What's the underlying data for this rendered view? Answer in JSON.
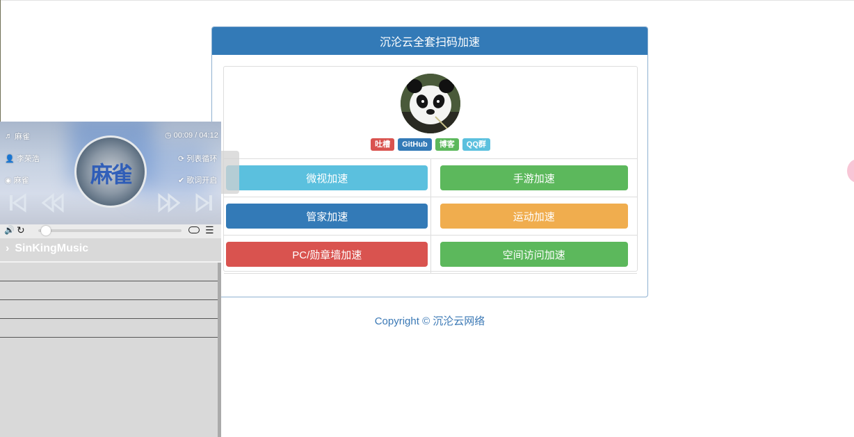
{
  "panel": {
    "title": "沉沦云全套扫码加速"
  },
  "tags": [
    {
      "label": "吐槽",
      "color": "#d9534f"
    },
    {
      "label": "GitHub",
      "color": "#337ab7"
    },
    {
      "label": "博客",
      "color": "#5cb85c"
    },
    {
      "label": "QQ群",
      "color": "#5bc0de"
    }
  ],
  "buttons": {
    "weishi": "微视加速",
    "shouyou": "手游加速",
    "guanjia": "管家加速",
    "yundong": "运动加速",
    "pc_medal": "PC/勋章墙加速",
    "space_visit": "空间访问加速"
  },
  "footer": {
    "copyright": "Copyright © 沉沦云网络"
  },
  "player": {
    "song": "麻雀",
    "time": "00:09 / 04:12",
    "artist": "李荣浩",
    "loop_mode": "列表循环",
    "album": "麻雀",
    "lyrics": "歌词开启",
    "disc_title": "麻雀",
    "brand": "SinKingMusic",
    "progress": 0.04,
    "list_items": [
      "",
      "",
      "",
      ""
    ]
  }
}
